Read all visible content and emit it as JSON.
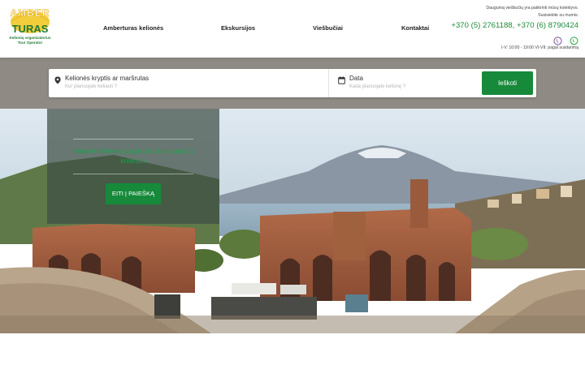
{
  "brand": {
    "logo_top": "AMBER",
    "logo_main": "TURAS",
    "tagline_1": "Kelionių organizatorius",
    "tagline_2": "Tour Operator"
  },
  "nav": {
    "items": [
      {
        "label": "Amberturas kelionės"
      },
      {
        "label": "Ekskursijos"
      },
      {
        "label": "Viešbučiai"
      },
      {
        "label": "Kontaktai"
      }
    ]
  },
  "contact": {
    "line1": "Daugumą viešbučių yra patikrinti mūsų kolektyvo.",
    "line2": "Susisiekite su mumis:",
    "phones": "+370 (5) 2761188, +370 (6) 8790424",
    "hours": "I-V: 10:00 - 19:00 VI-VII: pagal susitarimą",
    "viber_icon": "viber-icon",
    "whatsapp_icon": "whatsapp-icon"
  },
  "search": {
    "destination_label": "Kelionės kryptis ar maršrutas",
    "destination_placeholder": "Kur planuojate keliauti ?",
    "date_label": "Data",
    "date_placeholder": "Kada planuojate kelionę ?",
    "button_label": "Ieškoti"
  },
  "hero": {
    "text": "Raskite kelionės pagal Jūs dominančius kriterijus",
    "button_label": "EITI Į PAIEŠKĄ"
  },
  "colors": {
    "brand_green": "#168a3a",
    "phone_green": "#1e8a3c",
    "logo_yellow": "#f2c230"
  }
}
